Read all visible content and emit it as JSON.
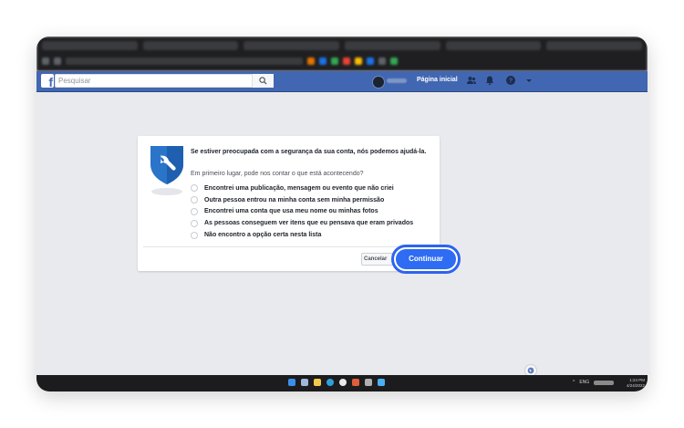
{
  "browser": {
    "tab_colors": [
      "#3a3b3e",
      "#3a3b3e",
      "#3a3b3e",
      "#3a3b3e",
      "#3a3b3e",
      "#3a3b3e"
    ]
  },
  "facebook": {
    "logo": "f",
    "search_placeholder": "Pesquisar",
    "home_label": "Página inicial",
    "brand_color": "#4267b2",
    "nav_icons": [
      "friends-icon",
      "notifications-bell-icon",
      "help-icon",
      "dropdown-arrow-icon"
    ]
  },
  "dialog": {
    "heading": "Se estiver preocupada com a segurança da sua conta, nós podemos ajudá-la.",
    "question": "Em primeiro lugar, pode nos contar o que está acontecendo?",
    "options": [
      "Encontrei uma publicação, mensagem ou evento que não criei",
      "Outra pessoa entrou na minha conta sem minha permissão",
      "Encontrei uma conta que usa meu nome ou minhas fotos",
      "As pessoas conseguem ver itens que eu pensava que eram privados",
      "Não encontro a opção certa nesta lista"
    ],
    "cancel_label": "Cancelar",
    "continue_label": "Continuar",
    "highlight_color": "#2d63f0"
  },
  "taskbar": {
    "tray_lang": "ENG",
    "clock_time": "1:24 PM",
    "clock_date": "4/24/2022"
  }
}
